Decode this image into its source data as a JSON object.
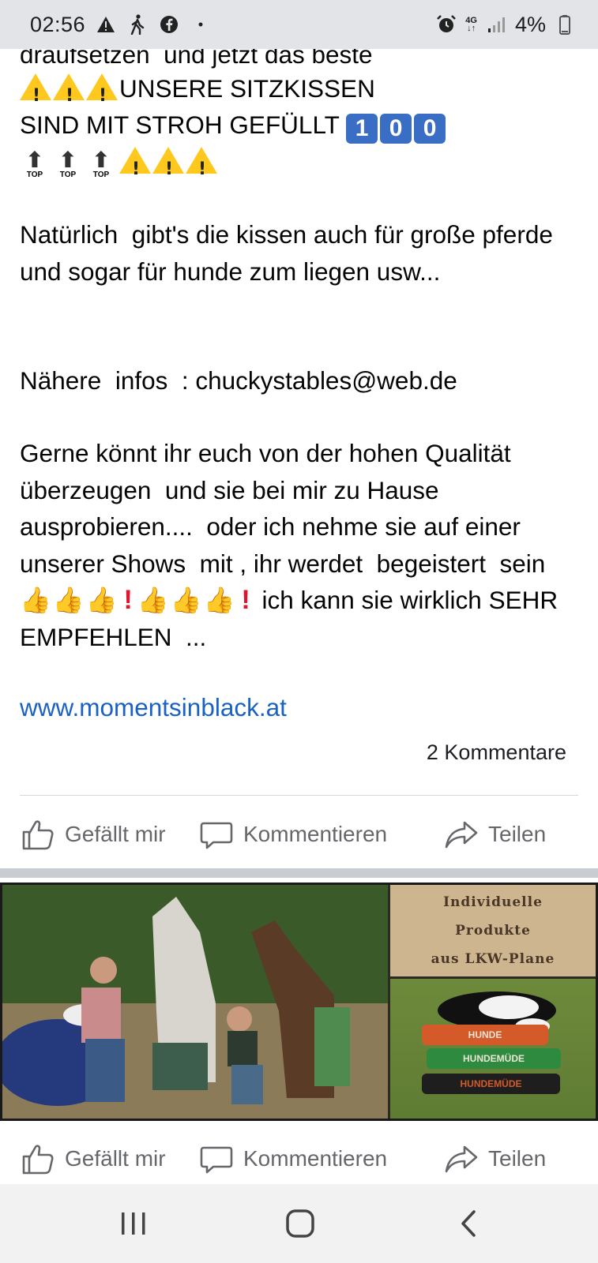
{
  "status_bar": {
    "time": "02:56",
    "network": "4G",
    "battery": "4%",
    "icons": [
      "warning-icon",
      "walking-person-icon",
      "facebook-icon",
      "dot-icon",
      "alarm-icon",
      "signal-icon",
      "battery-icon"
    ]
  },
  "post": {
    "line_cut": "draufsetzen  und jetzt das beste",
    "line_sitzkissen": "UNSERE SITZKISSEN",
    "line_stroh": "SIND MIT STROH GEFÜLLT ",
    "keycaps": [
      "1",
      "0",
      "0"
    ],
    "top_label": "TOP",
    "para_kissen": "Natürlich  gibt's die kissen auch für große pferde und sogar für hunde zum liegen usw...",
    "para_infos": "Nähere  infos  : chuckystables@web.de",
    "para_gerne": "Gerne könnt ihr euch von der hohen Qualität  überzeugen  und sie bei mir zu Hause  ausprobieren....  oder ich nehme sie auf einer unserer Shows  mit , ihr werdet  begeistert  sein ",
    "para_empfehlen": " ich kann sie wirklich SEHR EMPFEHLEN  ...",
    "link": "www.momentsinblack.at",
    "comments": "2 Kommentare"
  },
  "actions": {
    "like": "Gefällt mir",
    "comment": "Kommentieren",
    "share": "Teilen"
  },
  "photo": {
    "title_lines": [
      "Individuelle",
      "Produkte",
      "aus LKW-Plane"
    ],
    "pillow_labels": [
      "HUNDE",
      "HUNDEMÜDE",
      "HUNDEMÜDE"
    ]
  },
  "colors": {
    "link": "#1a61c4",
    "status_bar": "#e3e4e8",
    "action_text": "#65676b"
  }
}
